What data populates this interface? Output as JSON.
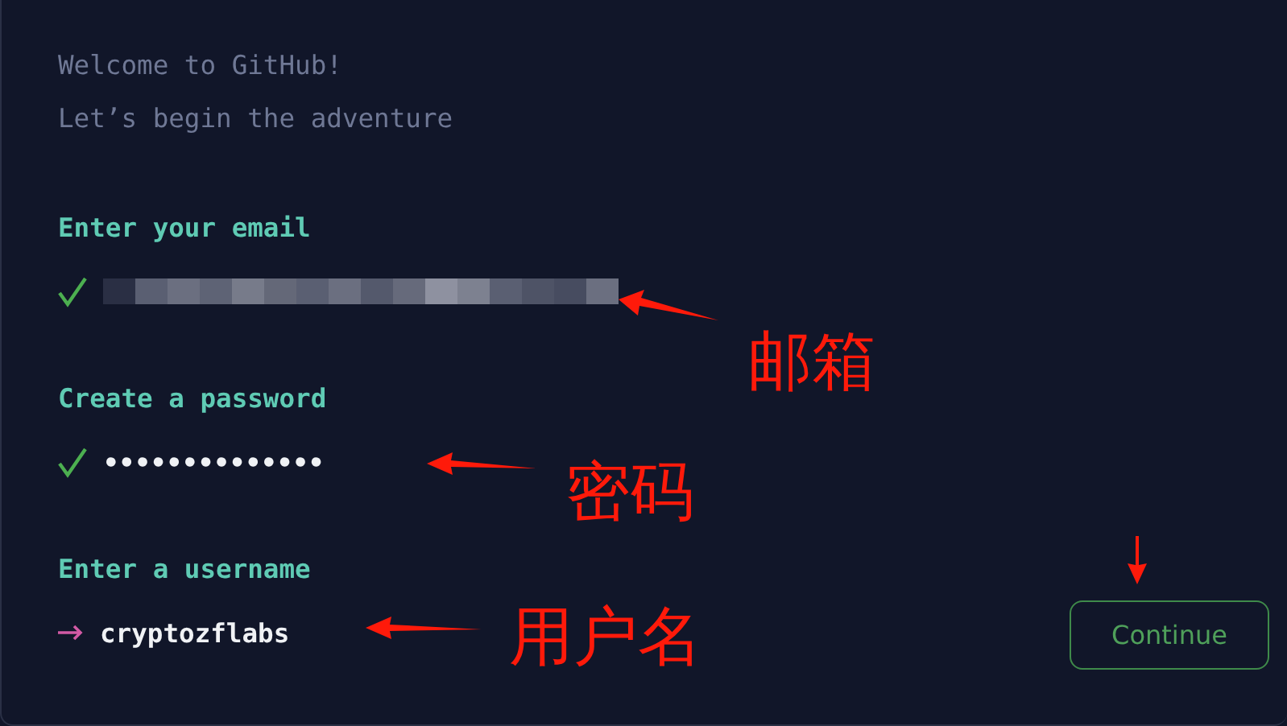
{
  "intro": [
    "Welcome to GitHub!",
    "Let’s begin the adventure"
  ],
  "fields": [
    {
      "label": "Enter your email",
      "done": true,
      "kind": "redacted"
    },
    {
      "label": "Create a password",
      "done": true,
      "kind": "text",
      "value": "••••••••••••••"
    },
    {
      "label": "Enter a username",
      "done": false,
      "kind": "text",
      "value": "cryptozflabs"
    }
  ],
  "button": {
    "label": "Continue"
  },
  "annotations": [
    {
      "text": "邮箱"
    },
    {
      "text": "密码"
    },
    {
      "text": "用户名"
    }
  ]
}
